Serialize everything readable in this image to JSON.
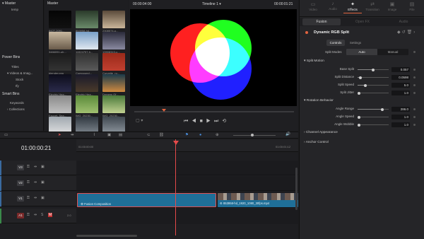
{
  "media_pool": {
    "bin_header": "Master",
    "bin_items": [
      "temp"
    ],
    "pool_header": "Master",
    "power_bins_label": "Power Bins",
    "power_bins_items": [
      "Titles",
      "Videos & Imag...",
      "Stock",
      "Ify"
    ],
    "smart_bins_label": "Smart Bins",
    "smart_bins_items": [
      "Keywords",
      "Collections"
    ],
    "clips": [
      {
        "label": "8427-2091..."
      },
      {
        "label": "853958-hd..."
      },
      {
        "label": "2308574-u..."
      },
      {
        "label": "3466091-uh..."
      },
      {
        "label": "11524757-h..."
      },
      {
        "label": "13908343-u..."
      },
      {
        "label": "blender.png"
      },
      {
        "label": "Compound..."
      },
      {
        "label": "Corvette_ru..."
      },
      {
        "label": "Electric Hea..."
      },
      {
        "label": "Electric Hea..."
      },
      {
        "label": "Dreams Of..."
      },
      {
        "label": "Faucet, Sea..."
      },
      {
        "label": "IMG_20230..."
      },
      {
        "label": "IMG_20230..."
      },
      {
        "label": ""
      },
      {
        "label": ""
      },
      {
        "label": ""
      }
    ]
  },
  "viewer": {
    "timecode_left": "00:00:04:00",
    "timeline_name": "Timeline 1",
    "timecode_right": "00:00:01:21"
  },
  "inspector": {
    "tabs": [
      {
        "label": "Video",
        "active": false
      },
      {
        "label": "Audio",
        "active": false
      },
      {
        "label": "Effects",
        "active": true
      },
      {
        "label": "Transition",
        "active": false
      },
      {
        "label": "Image",
        "active": false
      },
      {
        "label": "File",
        "active": false
      }
    ],
    "subtabs": [
      "Fusion",
      "Open FX",
      "Audio"
    ],
    "effect_name": "Dynamic RGB Split",
    "controls_tabs": [
      "Controls",
      "Settings"
    ],
    "split_modes_label": "Split Modes",
    "split_modes_options": [
      "Auto",
      "Manual"
    ],
    "sections": {
      "split_motion": "Split Motion",
      "rotation_behavior": "Rotation Behavior",
      "channel_appearance": "Channel Appearance",
      "anchor_control": "Anchor Control"
    },
    "params_split": [
      {
        "label": "Base Split",
        "value": "0.057",
        "pos": 0.5
      },
      {
        "label": "Split Distance",
        "value": "0.0598",
        "pos": 0.1
      },
      {
        "label": "Split Speed",
        "value": "5.0",
        "pos": 0.25
      },
      {
        "label": "Split Jitter",
        "value": "1.0",
        "pos": 0.05
      }
    ],
    "params_rotation": [
      {
        "label": "Angle Range",
        "value": "286.0",
        "pos": 0.8
      },
      {
        "label": "Angle Speed",
        "value": "1.0",
        "pos": 0.05
      },
      {
        "label": "Angle Wobble",
        "value": "1.0",
        "pos": 0.05
      }
    ]
  },
  "timeline": {
    "timecode": "01:00:00:21",
    "ruler_start": "01:00:00:00",
    "ruler_end": "01:00:01:12",
    "tracks": [
      "V3",
      "V2",
      "V1",
      "A1"
    ],
    "audio_level": "2.0",
    "clip_fusion": "Fusion Composition",
    "clip_video": "853958-hd_1920_1080_30fps.mp4"
  },
  "colors": {
    "accent": "#e0633f",
    "clip_blue": "#1f6f98",
    "playhead": "#e54a4a"
  }
}
